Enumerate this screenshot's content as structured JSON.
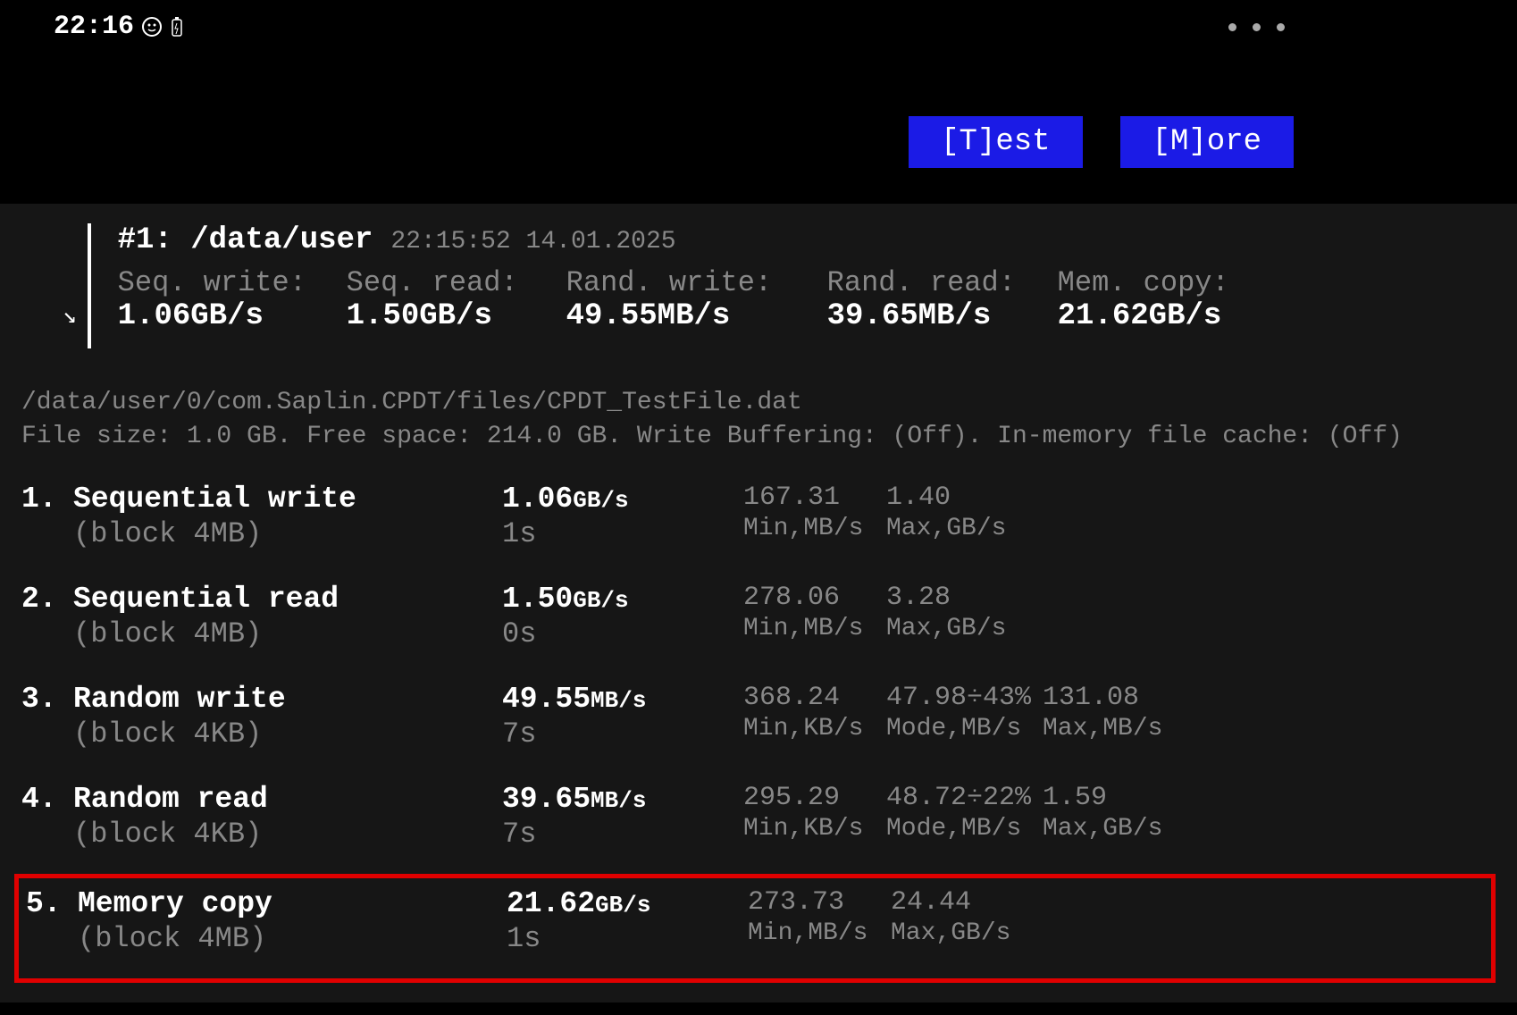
{
  "status_bar": {
    "time": "22:16"
  },
  "buttons": {
    "test": "[T]est",
    "more": "[M]ore"
  },
  "summary": {
    "run_label": "#1: /data/user",
    "timestamp": "22:15:52 14.01.2025",
    "metrics": [
      {
        "label": "Seq. write:",
        "value": "1.06GB/s"
      },
      {
        "label": "Seq. read:",
        "value": "1.50GB/s"
      },
      {
        "label": "Rand. write:",
        "value": "49.55MB/s"
      },
      {
        "label": "Rand. read:",
        "value": "39.65MB/s"
      },
      {
        "label": "Mem. copy:",
        "value": "21.62GB/s"
      }
    ]
  },
  "file_info": {
    "path": "/data/user/0/com.Saplin.CPDT/files/CPDT_TestFile.dat",
    "details": "File size: 1.0 GB. Free space: 214.0 GB. Write Buffering: (Off). In-memory file cache: (Off)"
  },
  "tests": [
    {
      "num": "1.",
      "name": "Sequential write",
      "block": "(block 4MB)",
      "speed_val": "1.06",
      "speed_unit": "GB/s",
      "duration": "1s",
      "stats": [
        {
          "value": "167.31",
          "label": "Min,MB/s"
        },
        {
          "value": "1.40",
          "label": "Max,GB/s"
        }
      ]
    },
    {
      "num": "2.",
      "name": "Sequential read",
      "block": "(block 4MB)",
      "speed_val": "1.50",
      "speed_unit": "GB/s",
      "duration": "0s",
      "stats": [
        {
          "value": "278.06",
          "label": "Min,MB/s"
        },
        {
          "value": "3.28",
          "label": "Max,GB/s"
        }
      ]
    },
    {
      "num": "3.",
      "name": "Random write",
      "block": "(block 4KB)",
      "speed_val": "49.55",
      "speed_unit": "MB/s",
      "duration": "7s",
      "stats": [
        {
          "value": "368.24",
          "label": "Min,KB/s"
        },
        {
          "value": "47.98÷43%",
          "label": "Mode,MB/s"
        },
        {
          "value": "131.08",
          "label": "Max,MB/s"
        }
      ]
    },
    {
      "num": "4.",
      "name": "Random read",
      "block": "(block 4KB)",
      "speed_val": "39.65",
      "speed_unit": "MB/s",
      "duration": "7s",
      "stats": [
        {
          "value": "295.29",
          "label": "Min,KB/s"
        },
        {
          "value": "48.72÷22%",
          "label": "Mode,MB/s"
        },
        {
          "value": "1.59",
          "label": "Max,GB/s"
        }
      ]
    },
    {
      "num": "5.",
      "name": "Memory copy",
      "block": "(block 4MB)",
      "speed_val": "21.62",
      "speed_unit": "GB/s",
      "duration": "1s",
      "stats": [
        {
          "value": "273.73",
          "label": "Min,MB/s"
        },
        {
          "value": "24.44",
          "label": "Max,GB/s"
        }
      ]
    }
  ]
}
